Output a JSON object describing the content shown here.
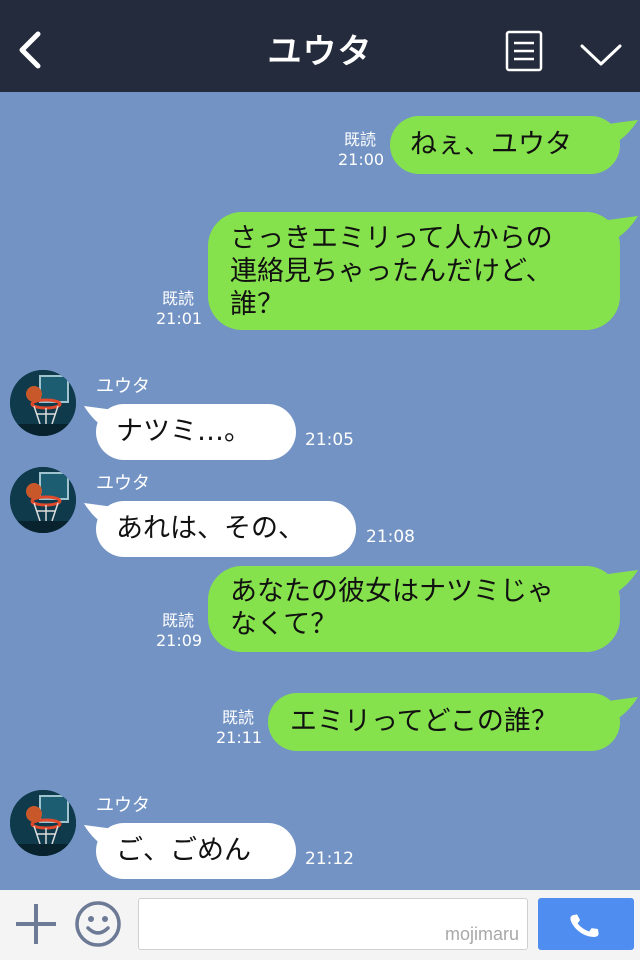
{
  "header": {
    "title": "ユウタ"
  },
  "icons": {
    "back": "back-chevron-icon",
    "menu": "list-menu-icon",
    "collapse": "chevron-down-icon",
    "add": "plus-icon",
    "emoji": "smiley-icon",
    "call": "phone-icon",
    "avatar": "basketball-hoop-avatar"
  },
  "colors": {
    "background": "#7393c4",
    "header": "#242b3c",
    "sent_bubble": "#86e24c",
    "received_bubble": "#ffffff",
    "call_button": "#4f8ef0"
  },
  "messages": [
    {
      "type": "sent",
      "text": "ねぇ、ユウタ",
      "read": "既読",
      "time": "21:00"
    },
    {
      "type": "sent",
      "lines": [
        "さっきエミリって人からの",
        "連絡見ちゃったんだけど、",
        "誰？"
      ],
      "read": "既読",
      "time": "21:01"
    },
    {
      "type": "received",
      "sender": "ユウタ",
      "text": "ナツミ…。",
      "time": "21:05"
    },
    {
      "type": "received",
      "sender": "ユウタ",
      "text": "あれは、その、",
      "time": "21:08"
    },
    {
      "type": "sent",
      "lines": [
        "あなたの彼女はナツミじゃ",
        "なくて？"
      ],
      "read": "既読",
      "time": "21:09"
    },
    {
      "type": "sent",
      "text": "エミリってどこの誰？",
      "read": "既読",
      "time": "21:11"
    },
    {
      "type": "received",
      "sender": "ユウタ",
      "text": "ご、ごめん",
      "time": "21:12"
    }
  ],
  "input": {
    "placeholder": "",
    "watermark": "mojimaru"
  }
}
